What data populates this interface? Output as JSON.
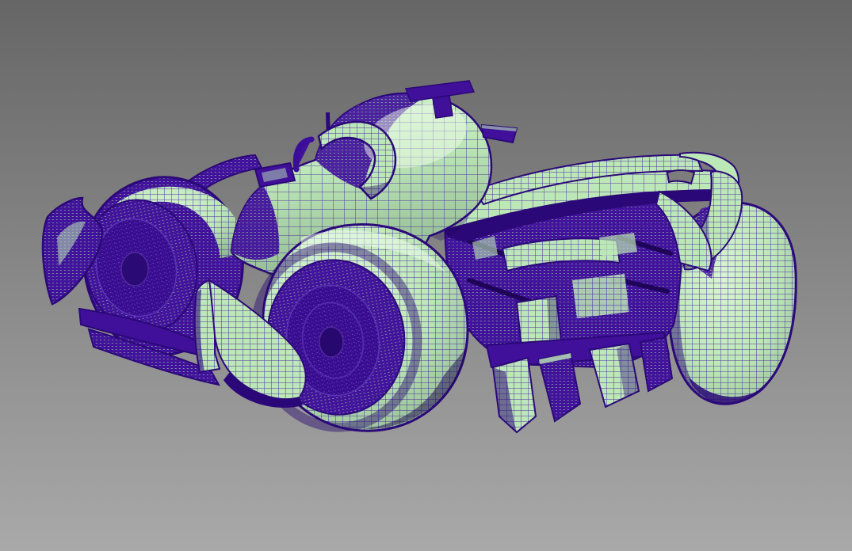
{
  "viewport": {
    "description": "3D viewport, shaded-with-wireframe render of a Formula 1 race car seen from the rear three-quarter, floating on a gray gradient background",
    "shading_mode": "shaded + wireframe",
    "colors": {
      "background_top": "#666666",
      "background_bottom": "#a9a9a9",
      "wireframe": "#3c0ea2",
      "wireframe_dark": "#2b0877",
      "dense_mesh": "#40109b",
      "surface": "#bce7b7",
      "surface_highlight": "#d8f4d3",
      "surface_shadow": "#8fb790",
      "rim": "#380d90",
      "hole_fill": "#7d7d7d"
    },
    "model": {
      "name": "formula-1-car",
      "view": "rear-three-quarter",
      "parts": [
        "front-left-wheel",
        "front-wing",
        "floor-edge",
        "sidepod-body",
        "airbox-engine-cover",
        "cockpit",
        "halo",
        "wing-mirror",
        "antenna",
        "t-cam",
        "rear-left-wheel",
        "rear-right-wheel",
        "rear-wing",
        "rear-wing-endplate",
        "engine-gearbox-cluster",
        "diffuser"
      ]
    }
  }
}
